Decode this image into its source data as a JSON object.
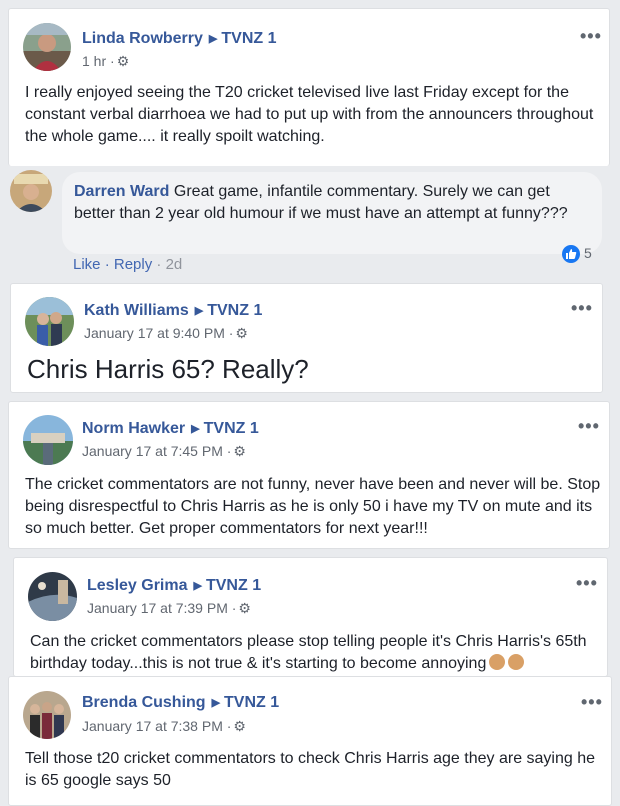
{
  "posts": [
    {
      "author": "Linda Rowberry",
      "target": "TVNZ 1",
      "time": "1 hr ·",
      "text": "I really enjoyed seeing the T20 cricket televised live last Friday except for the constant verbal diarrhoea we had to put up with from the announcers throughout the whole game.... it really spoilt watching."
    },
    {
      "author": "Kath Williams",
      "target": "TVNZ 1",
      "time": "January 17 at 9:40 PM ·",
      "text": "Chris Harris 65? Really?"
    },
    {
      "author": "Norm Hawker",
      "target": "TVNZ 1",
      "time": "January 17 at 7:45 PM ·",
      "text": "The cricket commentators are not funny, never have been and never will be. Stop being disrespectful to Chris Harris as he is only 50 i have my TV on mute and its so much better. Get proper commentators for next year!!!"
    },
    {
      "author": "Lesley Grima",
      "target": "TVNZ 1",
      "time": "January 17 at 7:39 PM ·",
      "text": "Can the cricket commentators please stop telling people it's Chris Harris's 65th birthday today...this is not true & it's starting to become annoying"
    },
    {
      "author": "Brenda Cushing",
      "target": "TVNZ 1",
      "time": "January 17 at 7:38 PM ·",
      "text": "Tell those t20 cricket commentators to check Chris Harris age they are saying he is 65 google says 50"
    }
  ],
  "comment": {
    "author": "Darren Ward",
    "text": "Great game, infantile commentary. Surely we can get better than 2 year old humour if we must have an attempt at funny???",
    "like": "Like",
    "reply": "Reply",
    "date": "2d",
    "reaction_count": "5"
  },
  "menu_glyph": "•••",
  "arrow_glyph": "▶",
  "gear_glyph": "⚙",
  "separator": "·"
}
